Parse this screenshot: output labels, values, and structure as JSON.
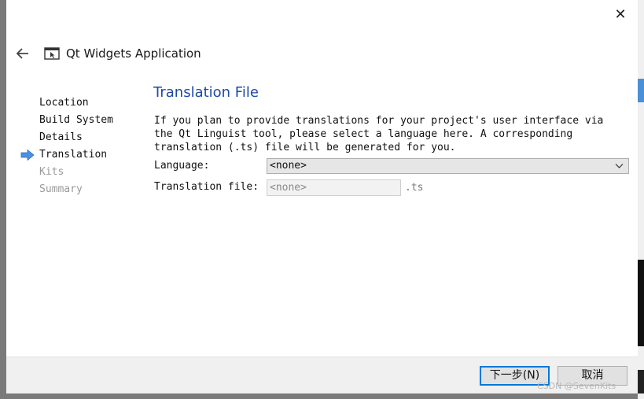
{
  "window": {
    "title": "Qt Widgets Application"
  },
  "wizard": {
    "steps": [
      {
        "label": "Location",
        "state": "done"
      },
      {
        "label": "Build System",
        "state": "done"
      },
      {
        "label": "Details",
        "state": "done"
      },
      {
        "label": "Translation",
        "state": "current"
      },
      {
        "label": "Kits",
        "state": "pending"
      },
      {
        "label": "Summary",
        "state": "pending"
      }
    ]
  },
  "page": {
    "title": "Translation File",
    "description": "If you plan to provide translations for your project's user interface via the Qt Linguist tool, please select a language here. A corresponding translation (.ts) file will be generated for you.",
    "language_label": "Language:",
    "language_value": "<none>",
    "translation_file_label": "Translation file:",
    "translation_file_value": "<none>",
    "translation_file_ext": ".ts"
  },
  "buttons": {
    "next": "下一步(N)",
    "cancel": "取消"
  },
  "watermark": "CSDN @SevenKits",
  "colors": {
    "accent": "#1e49a8",
    "current_step_arrow": "#4a8fe0",
    "default_button_border": "#0078d7"
  }
}
